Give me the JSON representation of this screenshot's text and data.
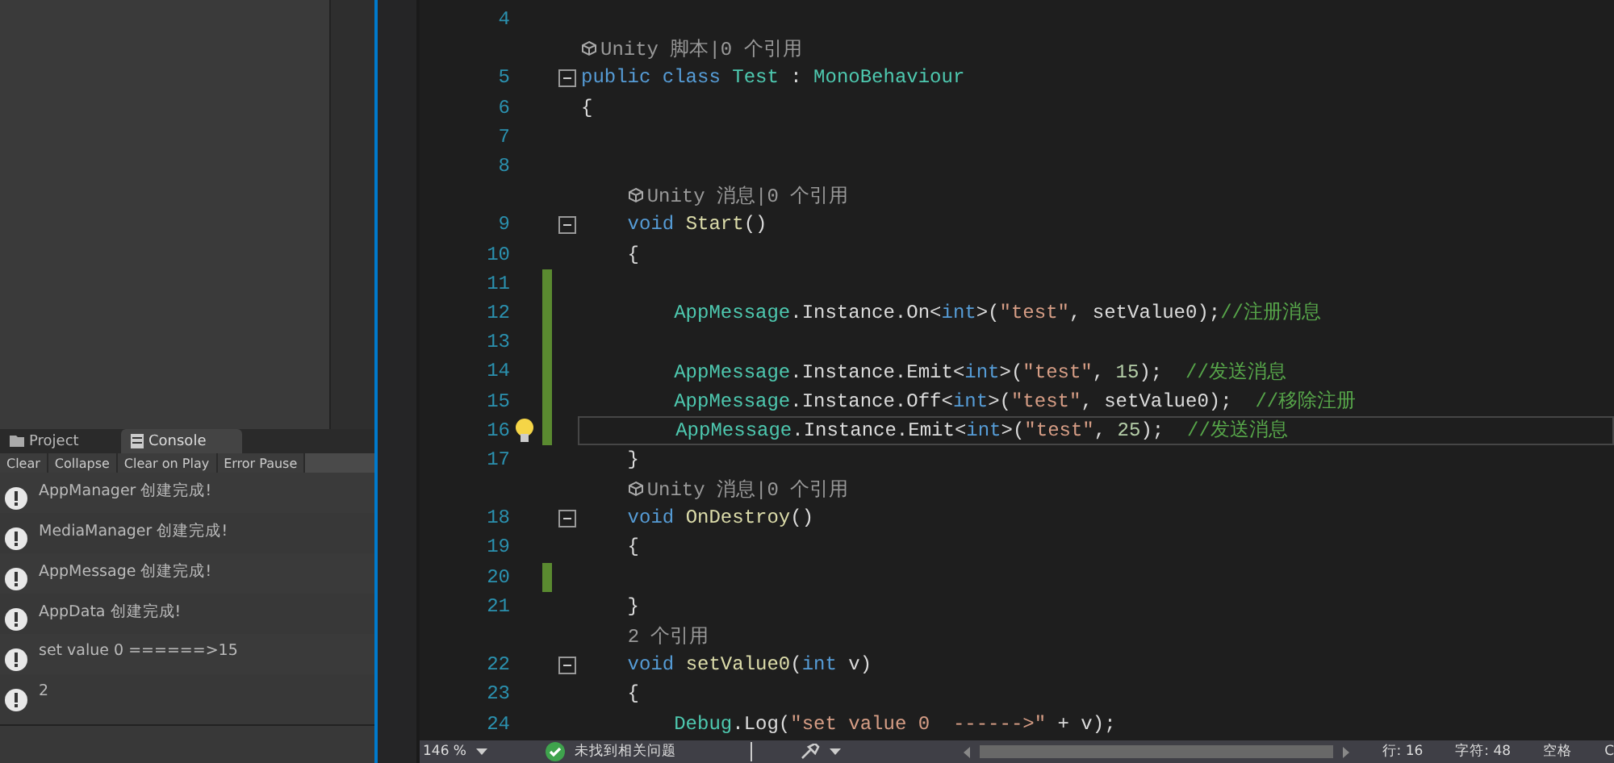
{
  "left_panel": {
    "tabs": [
      {
        "label": "Project",
        "selected": false
      },
      {
        "label": "Console",
        "selected": true
      }
    ],
    "toolbar": [
      "Clear",
      "Collapse",
      "Clear on Play",
      "Error Pause"
    ],
    "logs": [
      {
        "text": "AppManager 创建完成!"
      },
      {
        "text": "MediaManager 创建完成!"
      },
      {
        "text": "AppMessage 创建完成!"
      },
      {
        "text": "AppData 创建完成!"
      },
      {
        "text": "set value 0  ======>15"
      },
      {
        "text": "2"
      }
    ]
  },
  "editor": {
    "rows": [
      {
        "kind": "code",
        "num": "4",
        "tokens": []
      },
      {
        "kind": "lens",
        "lead": "",
        "icon": true,
        "text": "Unity 脚本|0 个引用"
      },
      {
        "kind": "code",
        "num": "5",
        "fold": true,
        "tokens": [
          {
            "kind": "keyword",
            "text": "public class "
          },
          {
            "kind": "type",
            "text": "Test"
          },
          {
            "kind": "plain",
            "text": " : "
          },
          {
            "kind": "type",
            "text": "MonoBehaviour"
          }
        ]
      },
      {
        "kind": "code",
        "num": "6",
        "tokens": [
          {
            "kind": "plain",
            "text": "{"
          }
        ]
      },
      {
        "kind": "code",
        "num": "7",
        "tokens": []
      },
      {
        "kind": "code",
        "num": "8",
        "tokens": []
      },
      {
        "kind": "lens",
        "lead": "    ",
        "icon": true,
        "text": "Unity 消息|0 个引用"
      },
      {
        "kind": "code",
        "num": "9",
        "fold": true,
        "tokens": [
          {
            "kind": "keyword",
            "text": "    void "
          },
          {
            "kind": "method",
            "text": "Start"
          },
          {
            "kind": "plain",
            "text": "()"
          }
        ]
      },
      {
        "kind": "code",
        "num": "10",
        "tokens": [
          {
            "kind": "plain",
            "text": "    {"
          }
        ]
      },
      {
        "kind": "code",
        "num": "11",
        "changed": true,
        "tokens": []
      },
      {
        "kind": "code",
        "num": "12",
        "changed": true,
        "tokens": [
          {
            "kind": "type",
            "text": "        AppMessage"
          },
          {
            "kind": "plain",
            "text": ".Instance.On<"
          },
          {
            "kind": "keyword",
            "text": "int"
          },
          {
            "kind": "plain",
            "text": ">("
          },
          {
            "kind": "string",
            "text": "\"test\""
          },
          {
            "kind": "plain",
            "text": ", setValue0);"
          },
          {
            "kind": "comment",
            "text": "//注册消息"
          }
        ]
      },
      {
        "kind": "code",
        "num": "13",
        "changed": true,
        "tokens": []
      },
      {
        "kind": "code",
        "num": "14",
        "changed": true,
        "tokens": [
          {
            "kind": "type",
            "text": "        AppMessage"
          },
          {
            "kind": "plain",
            "text": ".Instance.Emit<"
          },
          {
            "kind": "keyword",
            "text": "int"
          },
          {
            "kind": "plain",
            "text": ">("
          },
          {
            "kind": "string",
            "text": "\"test\""
          },
          {
            "kind": "plain",
            "text": ", "
          },
          {
            "kind": "number",
            "text": "15"
          },
          {
            "kind": "plain",
            "text": ");  "
          },
          {
            "kind": "comment",
            "text": "//发送消息"
          }
        ]
      },
      {
        "kind": "code",
        "num": "15",
        "changed": true,
        "tokens": [
          {
            "kind": "type",
            "text": "        AppMessage"
          },
          {
            "kind": "plain",
            "text": ".Instance.Off<"
          },
          {
            "kind": "keyword",
            "text": "int"
          },
          {
            "kind": "plain",
            "text": ">("
          },
          {
            "kind": "string",
            "text": "\"test\""
          },
          {
            "kind": "plain",
            "text": ", setValue0);  "
          },
          {
            "kind": "comment",
            "text": "//移除注册"
          }
        ]
      },
      {
        "kind": "code",
        "num": "16",
        "changed": true,
        "current": true,
        "lightbulb": true,
        "tokens": [
          {
            "kind": "type",
            "text": "        AppMessage"
          },
          {
            "kind": "plain",
            "text": ".Instance.Emit<"
          },
          {
            "kind": "keyword",
            "text": "int"
          },
          {
            "kind": "plain",
            "text": ">("
          },
          {
            "kind": "string",
            "text": "\"test\""
          },
          {
            "kind": "plain",
            "text": ", "
          },
          {
            "kind": "number",
            "text": "25"
          },
          {
            "kind": "plain",
            "text": ");  "
          },
          {
            "kind": "comment",
            "text": "//发送消息"
          }
        ]
      },
      {
        "kind": "code",
        "num": "17",
        "tokens": [
          {
            "kind": "plain",
            "text": "    }"
          }
        ]
      },
      {
        "kind": "lens",
        "lead": "    ",
        "icon": true,
        "text": "Unity 消息|0 个引用"
      },
      {
        "kind": "code",
        "num": "18",
        "fold": true,
        "tokens": [
          {
            "kind": "keyword",
            "text": "    void "
          },
          {
            "kind": "method",
            "text": "OnDestroy"
          },
          {
            "kind": "plain",
            "text": "()"
          }
        ]
      },
      {
        "kind": "code",
        "num": "19",
        "tokens": [
          {
            "kind": "plain",
            "text": "    {"
          }
        ]
      },
      {
        "kind": "code",
        "num": "20",
        "changed": true,
        "tokens": []
      },
      {
        "kind": "code",
        "num": "21",
        "tokens": [
          {
            "kind": "plain",
            "text": "    }"
          }
        ]
      },
      {
        "kind": "lens",
        "lead": "    ",
        "icon": false,
        "text": "2 个引用"
      },
      {
        "kind": "code",
        "num": "22",
        "fold": true,
        "tokens": [
          {
            "kind": "keyword",
            "text": "    void "
          },
          {
            "kind": "method",
            "text": "setValue0"
          },
          {
            "kind": "plain",
            "text": "("
          },
          {
            "kind": "keyword",
            "text": "int"
          },
          {
            "kind": "plain",
            "text": " v)"
          }
        ]
      },
      {
        "kind": "code",
        "num": "23",
        "tokens": [
          {
            "kind": "plain",
            "text": "    {"
          }
        ]
      },
      {
        "kind": "code",
        "num": "24",
        "tokens": [
          {
            "kind": "type",
            "text": "        Debug"
          },
          {
            "kind": "plain",
            "text": ".Log("
          },
          {
            "kind": "string",
            "text": "\"set value 0  ------>\""
          },
          {
            "kind": "plain",
            "text": " + v);"
          }
        ]
      }
    ]
  },
  "status_bar": {
    "zoom": "146 %",
    "issues": "未找到相关问题",
    "line": "行: 16",
    "char": "字符: 48",
    "indent": "空格",
    "cut": "C"
  }
}
